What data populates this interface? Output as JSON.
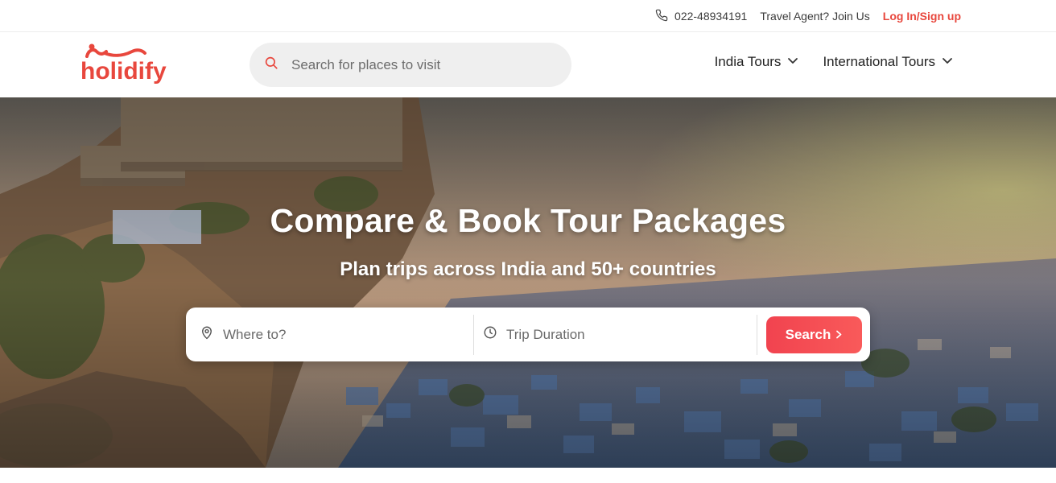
{
  "topbar": {
    "phone": "022-48934191",
    "agent": "Travel Agent? Join Us",
    "login": "Log In/Sign up",
    "phone_icon": "phone-icon"
  },
  "header": {
    "logo_text": "holidify",
    "search_placeholder": "Search for places to visit",
    "nav": [
      {
        "label": "India Tours",
        "icon": "chevron-down-icon"
      },
      {
        "label": "International Tours",
        "icon": "chevron-down-icon"
      }
    ]
  },
  "hero": {
    "title": "Compare & Book Tour Packages",
    "subtitle": "Plan trips across India and 50+ countries",
    "where_placeholder": "Where to?",
    "duration_placeholder": "Trip Duration",
    "search_label": "Search"
  },
  "colors": {
    "brand": "#e8473d",
    "button": "#f1434f"
  }
}
